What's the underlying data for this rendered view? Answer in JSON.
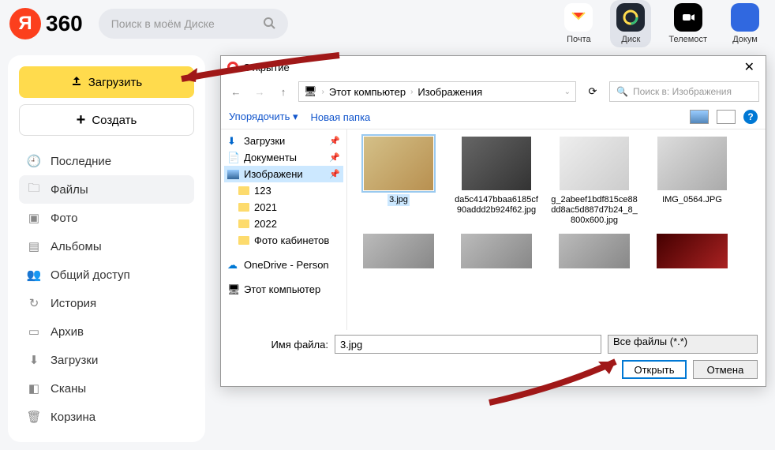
{
  "header": {
    "logo_letter": "Я",
    "logo_text": "360",
    "search_placeholder": "Поиск в моём Диске",
    "services": [
      {
        "label": "Почта"
      },
      {
        "label": "Диск"
      },
      {
        "label": "Телемост"
      },
      {
        "label": "Докум"
      }
    ]
  },
  "sidebar": {
    "upload_label": "Загрузить",
    "create_label": "Создать",
    "items": [
      {
        "label": "Последние"
      },
      {
        "label": "Файлы"
      },
      {
        "label": "Фото"
      },
      {
        "label": "Альбомы"
      },
      {
        "label": "Общий доступ"
      },
      {
        "label": "История"
      },
      {
        "label": "Архив"
      },
      {
        "label": "Загрузки"
      },
      {
        "label": "Сканы"
      },
      {
        "label": "Корзина"
      }
    ]
  },
  "dialog": {
    "title": "Открытие",
    "path_root": "Этот компьютер",
    "path_current": "Изображения",
    "search_placeholder": "Поиск в: Изображения",
    "organize_label": "Упорядочить",
    "new_folder_label": "Новая папка",
    "tree": [
      {
        "label": "Загрузки",
        "pinned": true,
        "icon": "download"
      },
      {
        "label": "Документы",
        "pinned": true,
        "icon": "doc"
      },
      {
        "label": "Изображени",
        "pinned": true,
        "icon": "img",
        "selected": true
      },
      {
        "label": "123",
        "icon": "folder"
      },
      {
        "label": "2021",
        "icon": "folder"
      },
      {
        "label": "2022",
        "icon": "folder"
      },
      {
        "label": "Фото кабинетов",
        "icon": "folder"
      },
      {
        "label": "OneDrive - Person",
        "icon": "onedrive"
      },
      {
        "label": "Этот компьютер",
        "icon": "pc"
      }
    ],
    "files": [
      {
        "name": "3.jpg",
        "selected": true
      },
      {
        "name": "da5c4147bbaa6185cf90addd2b924f62.jpg"
      },
      {
        "name": "g_2abeef1bdf815ce88dd8ac5d887d7b24_8_800x600.jpg"
      },
      {
        "name": "IMG_0564.JPG"
      }
    ],
    "filename_label": "Имя файла:",
    "filename_value": "3.jpg",
    "filter_value": "Все файлы (*.*)",
    "open_label": "Открыть",
    "cancel_label": "Отмена"
  }
}
